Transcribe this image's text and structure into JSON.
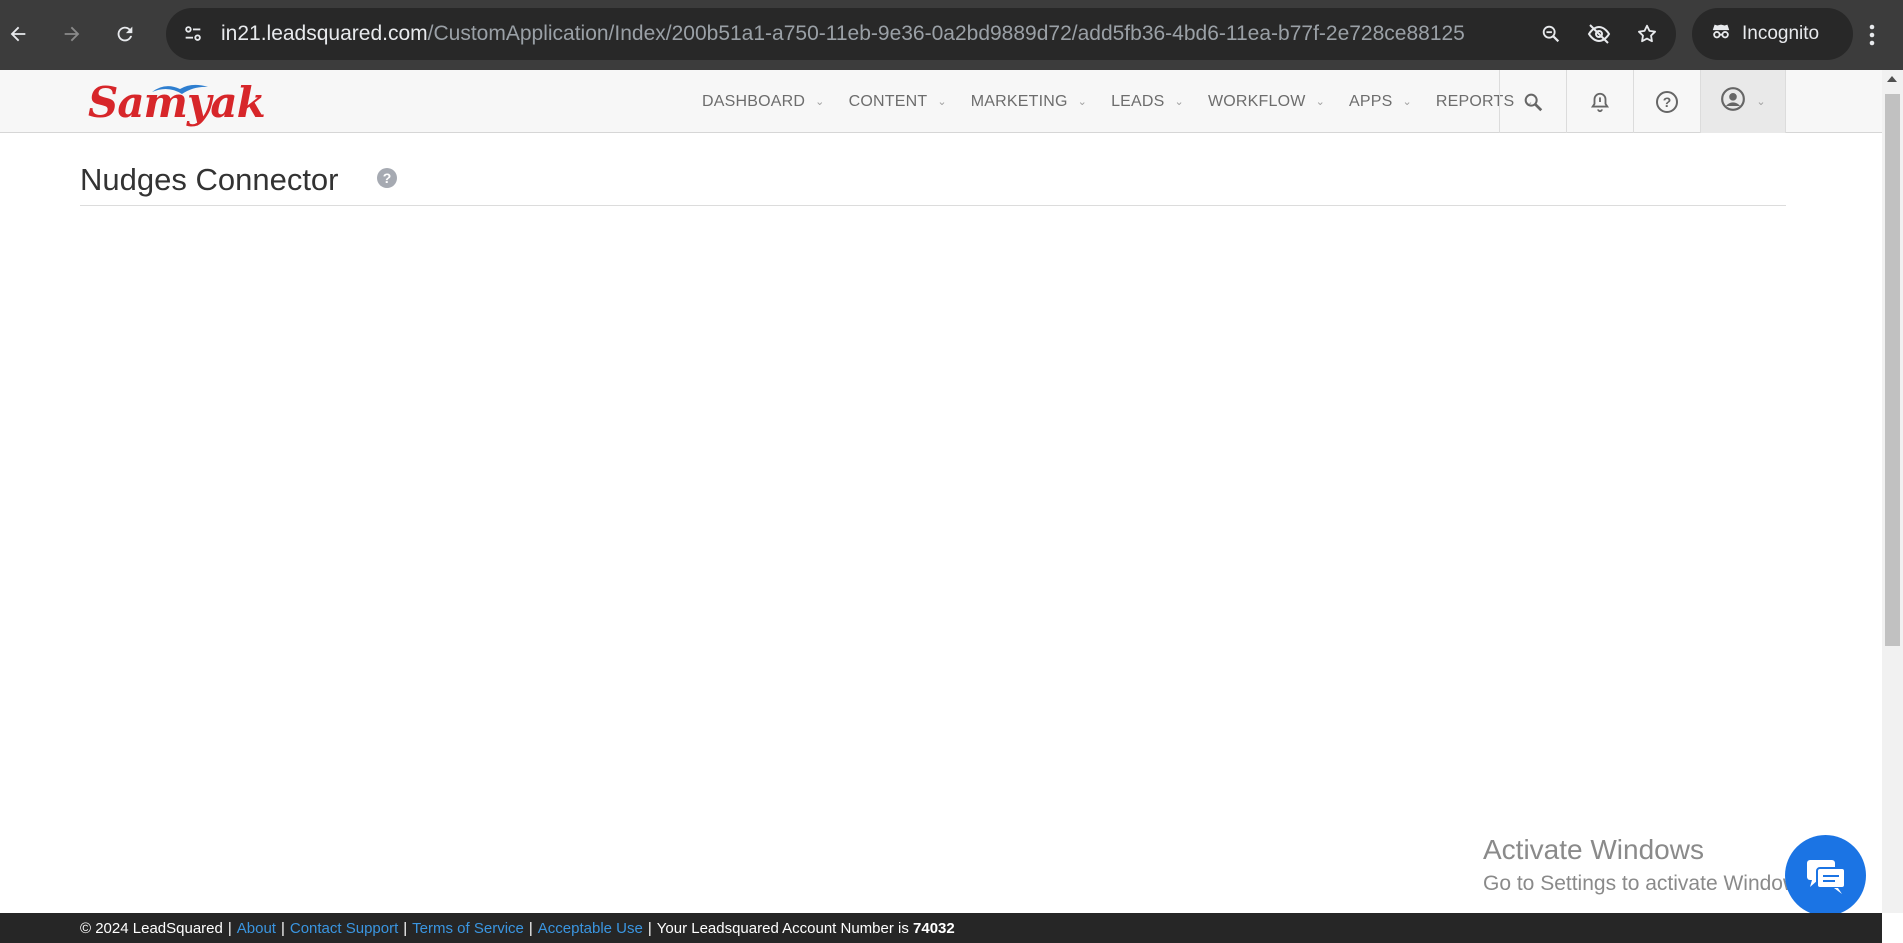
{
  "browser": {
    "url_host": "in21.leadsquared.com",
    "url_path": "/CustomApplication/Index/200b51a1-a750-11eb-9e36-0a2bd9889d72/add5fb36-4bd6-11ea-b77f-2e728ce88125",
    "incognito_label": "Incognito",
    "icons": [
      "back-arrow-icon",
      "forward-arrow-icon",
      "reload-icon",
      "site-info-icon",
      "zoom-icon",
      "eye-off-icon",
      "star-icon",
      "incognito-icon",
      "more-vert-icon"
    ]
  },
  "header": {
    "logo_text": "Samyak",
    "nav": [
      {
        "label": "DASHBOARD"
      },
      {
        "label": "CONTENT"
      },
      {
        "label": "MARKETING"
      },
      {
        "label": "LEADS"
      },
      {
        "label": "WORKFLOW"
      },
      {
        "label": "APPS"
      },
      {
        "label": "REPORTS"
      }
    ],
    "icons": [
      "search-icon",
      "bell-icon",
      "help-icon",
      "user-icon"
    ]
  },
  "page": {
    "title": "Nudges Connector",
    "help_badge": "?"
  },
  "watermark": {
    "title": "Activate Windows",
    "subtitle": "Go to Settings to activate Windows."
  },
  "footer": {
    "copyright": "© 2024 LeadSquared",
    "links": [
      "About",
      "Contact Support",
      "Terms of Service",
      "Acceptable Use"
    ],
    "account_text": "Your Leadsquared Account Number is",
    "account_number": "74032"
  },
  "colors": {
    "chrome_bg": "#3c3c3c",
    "omnibox_bg": "#282828",
    "logo_red": "#d7262a",
    "link_blue": "#3a95e0",
    "chat_blue": "#1b74e4",
    "footer_bg": "#262626"
  }
}
